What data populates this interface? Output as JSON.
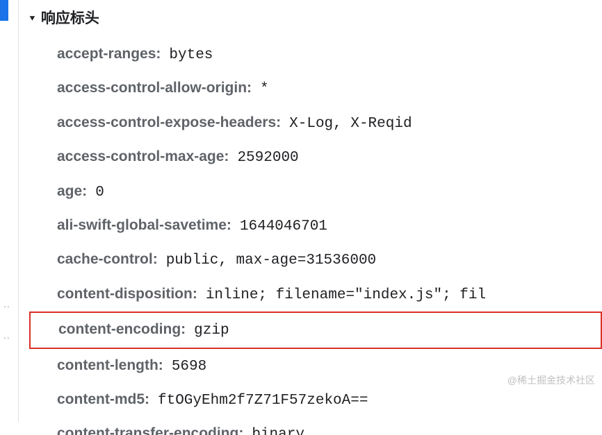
{
  "section": {
    "title": "响应标头"
  },
  "headers": [
    {
      "name": "accept-ranges:",
      "value": "bytes",
      "highlighted": false
    },
    {
      "name": "access-control-allow-origin:",
      "value": "*",
      "highlighted": false
    },
    {
      "name": "access-control-expose-headers:",
      "value": "X-Log, X-Reqid",
      "highlighted": false
    },
    {
      "name": "access-control-max-age:",
      "value": "2592000",
      "highlighted": false
    },
    {
      "name": "age:",
      "value": "0",
      "highlighted": false
    },
    {
      "name": "ali-swift-global-savetime:",
      "value": "1644046701",
      "highlighted": false
    },
    {
      "name": "cache-control:",
      "value": "public, max-age=31536000",
      "highlighted": false
    },
    {
      "name": "content-disposition:",
      "value": "inline; filename=\"index.js\"; fil",
      "highlighted": false
    },
    {
      "name": "content-encoding:",
      "value": "gzip",
      "highlighted": true
    },
    {
      "name": "content-length:",
      "value": "5698",
      "highlighted": false
    },
    {
      "name": "content-md5:",
      "value": "ftOGyEhm2f7Z71F57zekoA==",
      "highlighted": false
    },
    {
      "name": "content-transfer-encoding:",
      "value": "binary",
      "highlighted": false
    }
  ],
  "watermark": "@稀土掘金技术社区"
}
